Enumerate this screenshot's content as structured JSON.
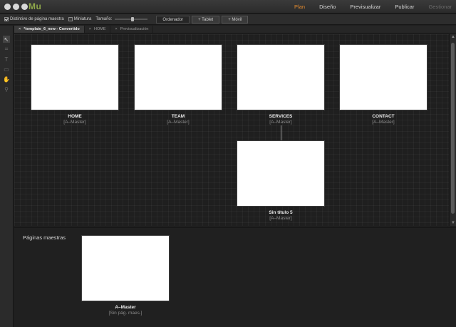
{
  "app": {
    "logo": "Mu"
  },
  "window_controls": [
    "close",
    "minimize",
    "zoom"
  ],
  "modes": [
    {
      "label": "Plan",
      "state": "active"
    },
    {
      "label": "Diseño",
      "state": "normal"
    },
    {
      "label": "Previsualizar",
      "state": "normal"
    },
    {
      "label": "Publicar",
      "state": "normal"
    },
    {
      "label": "Gestionar",
      "state": "disabled"
    }
  ],
  "options": {
    "master_badge": {
      "label": "Distintivo de página maestra",
      "checked": true
    },
    "thumbnail": {
      "label": "Miniatura",
      "checked": false
    },
    "size_label": "Tamaño:",
    "size_value": 0.55,
    "layouts": [
      {
        "label": "Ordenador",
        "selected": true
      },
      {
        "label": "+ Tablet",
        "selected": false
      },
      {
        "label": "+ Móvil",
        "selected": false
      }
    ]
  },
  "tools": [
    {
      "name": "selection-tool",
      "glyph": "↖",
      "active": true
    },
    {
      "name": "crop-tool",
      "glyph": "⌗",
      "active": false
    },
    {
      "name": "text-tool",
      "glyph": "T",
      "active": false
    },
    {
      "name": "rectangle-tool",
      "glyph": "▭",
      "active": false
    },
    {
      "name": "hand-tool",
      "glyph": "✋",
      "active": false
    },
    {
      "name": "zoom-tool",
      "glyph": "⚲",
      "active": false
    }
  ],
  "tabs": [
    {
      "label": "*template_6_new - Convertido",
      "active": true,
      "close": "×"
    },
    {
      "label": "HOME",
      "active": false,
      "close": "×"
    },
    {
      "label": "Previsualización",
      "active": false,
      "close": "×"
    }
  ],
  "pages": [
    {
      "name": "HOME",
      "master": "[A–Master]"
    },
    {
      "name": "TEAM",
      "master": "[A–Master]"
    },
    {
      "name": "SERVICES",
      "master": "[A–Master]"
    },
    {
      "name": "CONTACT",
      "master": "[A–Master]"
    },
    {
      "name": "Sin título 5",
      "master": "[A–Master]"
    }
  ],
  "masters_section": {
    "title": "Páginas maestras",
    "pages": [
      {
        "name": "A–Master",
        "master": "[Sin pág. maes.]"
      }
    ]
  },
  "colors": {
    "accent": "#e0892f",
    "logo": "#8fa84a",
    "background": "#1e1e1e",
    "thumbnail": "#ffffff"
  }
}
